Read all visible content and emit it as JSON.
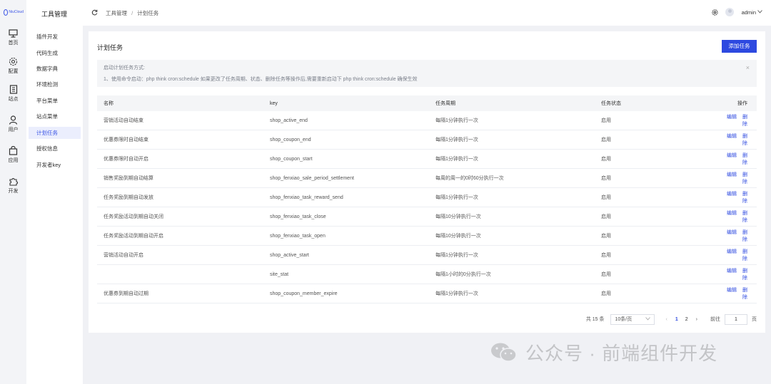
{
  "rail": {
    "logo_text": "NiuCloud",
    "items": [
      {
        "label": "首页",
        "icon": "monitor-icon"
      },
      {
        "label": "配置",
        "icon": "gear-icon"
      },
      {
        "label": "站点",
        "icon": "document-icon"
      },
      {
        "label": "用户",
        "icon": "user-icon"
      },
      {
        "label": "应用",
        "icon": "bag-icon"
      },
      {
        "label": "开发",
        "icon": "puzzle-icon"
      }
    ]
  },
  "submenu": {
    "title": "工具管理",
    "items": [
      {
        "label": "插件开发"
      },
      {
        "label": "代码生成"
      },
      {
        "label": "数据字典"
      },
      {
        "label": "环境检测"
      },
      {
        "label": "平台菜单"
      },
      {
        "label": "站点菜单"
      },
      {
        "label": "计划任务",
        "active": true
      },
      {
        "label": "授权信息"
      },
      {
        "label": "开发者key"
      }
    ]
  },
  "topbar": {
    "breadcrumb": [
      "工具管理",
      "计划任务"
    ],
    "separator": "/",
    "username": "admin"
  },
  "card": {
    "title": "计划任务",
    "add_button": "添加任务",
    "alert": {
      "line1": "启动计划任务方式:",
      "line2": "1、使用命令启动：php think cron:schedule 如果更改了任务周期、状态、删除任务等操作后,需要重新启动下 php think cron:schedule 确保生效",
      "close": "×"
    },
    "table": {
      "headers": {
        "name": "名称",
        "key": "key",
        "period": "任务周期",
        "status": "任务状态",
        "ops": "操作"
      },
      "edit_label": "编辑",
      "delete_label": "删除",
      "rows": [
        {
          "name": "营销活动自动结束",
          "key": "shop_active_end",
          "period": "每隔1分钟执行一次",
          "status": "启用"
        },
        {
          "name": "优惠券限时自动结束",
          "key": "shop_coupon_end",
          "period": "每隔1分钟执行一次",
          "status": "启用"
        },
        {
          "name": "优惠券限时自动开启",
          "key": "shop_coupon_start",
          "period": "每隔1分钟执行一次",
          "status": "启用"
        },
        {
          "name": "销售奖励到期自动结算",
          "key": "shop_fenxiao_sale_period_settlement",
          "period": "每周的周一的0时60分执行一次",
          "status": "启用"
        },
        {
          "name": "任务奖励到期自动发放",
          "key": "shop_fenxiao_task_reward_send",
          "period": "每隔1分钟执行一次",
          "status": "启用"
        },
        {
          "name": "任务奖励活动到期自动关闭",
          "key": "shop_fenxiao_task_close",
          "period": "每隔10分钟执行一次",
          "status": "启用"
        },
        {
          "name": "任务奖励活动到期自动开启",
          "key": "shop_fenxiao_task_open",
          "period": "每隔10分钟执行一次",
          "status": "启用"
        },
        {
          "name": "营销活动自动开启",
          "key": "shop_active_start",
          "period": "每隔1分钟执行一次",
          "status": "启用"
        },
        {
          "name": "",
          "key": "site_stat",
          "period": "每隔1小时的0分执行一次",
          "status": "启用"
        },
        {
          "name": "优惠券到期自动过期",
          "key": "shop_coupon_member_expire",
          "period": "每隔1分钟执行一次",
          "status": "启用"
        }
      ]
    },
    "pager": {
      "total": "共 15 条",
      "page_size": "10条/页",
      "prev": "‹",
      "next": "›",
      "pages": [
        "1",
        "2"
      ],
      "current_page": "1",
      "goto_label": "前往",
      "goto_value": "1",
      "goto_unit": "页"
    }
  },
  "watermark": {
    "text": "公众号 · 前端组件开发"
  }
}
